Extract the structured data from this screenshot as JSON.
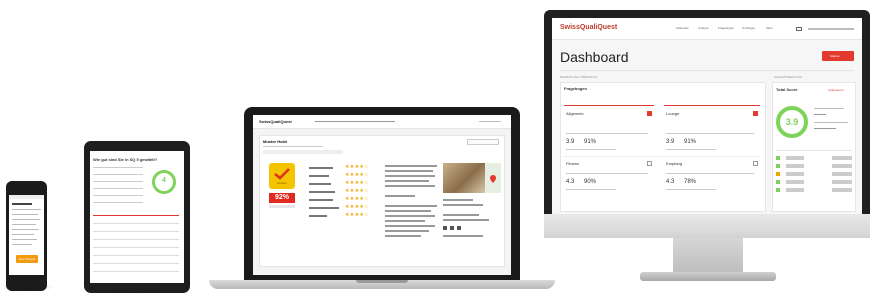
{
  "phone": {
    "cta_label": "Zum Tampel"
  },
  "tablet": {
    "heading": "Wie gut sind Sie in SQ 5 gewählt?",
    "score": "4"
  },
  "laptop": {
    "brand": "SwissQualiQuest",
    "company_title": "Muster Hotel",
    "rating_pct": "92%",
    "golden_label": "Golden"
  },
  "desktop": {
    "brand": "SwissQualiQuest",
    "nav": [
      "Startseite",
      "Analyse",
      "Fragebogen",
      "Umfragen",
      "Mehr"
    ],
    "page_title": "Dashboard",
    "action_button": "Starten",
    "left_section_label": "BEWERTUNG ÜBERSICHT",
    "right_section_label": "GESAMTWERTUNG",
    "panel_title": "Fragebogen",
    "cards": [
      {
        "name": "Allgemein",
        "score": "3.9",
        "pct": "91%",
        "checked": true
      },
      {
        "name": "Lounge",
        "score": "3.9",
        "pct": "91%",
        "checked": true
      },
      {
        "name": "Fitness",
        "score": "4.3",
        "pct": "90%",
        "checked": false
      },
      {
        "name": "Empfang",
        "score": "4.3",
        "pct": "78%",
        "checked": false
      }
    ],
    "total_title": "Total Score",
    "total_score": "3.9",
    "total_link": "Analysieren"
  },
  "colors": {
    "accent_red": "#e23a2e",
    "gauge_green": "#7fd35a",
    "cta_orange": "#f39c12",
    "star_gold": "#f0a500"
  }
}
